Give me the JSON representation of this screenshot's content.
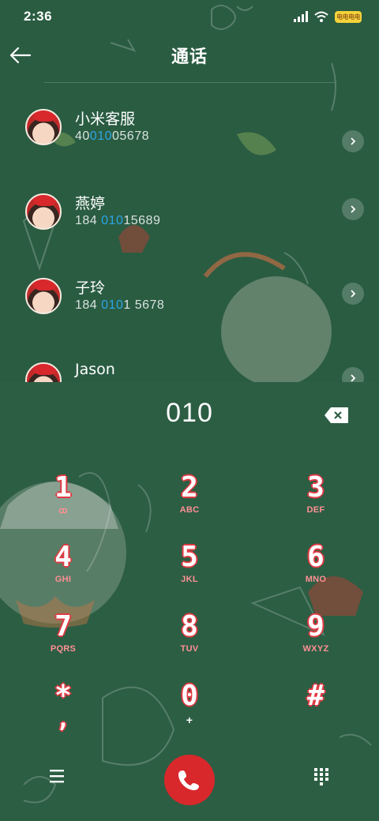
{
  "status_bar": {
    "time": "2:36",
    "battery_label": "电电电电",
    "icons": [
      "signal-icon",
      "wifi-icon",
      "battery-icon"
    ]
  },
  "header": {
    "title": "通话",
    "back_icon": "arrow-left-icon"
  },
  "contacts": [
    {
      "name": "小米客服",
      "number_pre": "40",
      "number_match": "010",
      "number_post": "05678"
    },
    {
      "name": "燕婷",
      "number_pre": "184 ",
      "number_match": "010",
      "number_post": "15689"
    },
    {
      "name": "子玲",
      "number_pre": "184 ",
      "number_match": "010",
      "number_post": "1 5678"
    },
    {
      "name": "Jason",
      "number_pre": "",
      "number_match": "",
      "number_post": ""
    }
  ],
  "dialer": {
    "input_value": "010",
    "backspace_icon": "backspace-icon",
    "keys": [
      {
        "digit": "1",
        "letters": "ꝏ"
      },
      {
        "digit": "2",
        "letters": "ABC"
      },
      {
        "digit": "3",
        "letters": "DEF"
      },
      {
        "digit": "4",
        "letters": "GHI"
      },
      {
        "digit": "5",
        "letters": "JKL"
      },
      {
        "digit": "6",
        "letters": "MNO"
      },
      {
        "digit": "7",
        "letters": "PQRS"
      },
      {
        "digit": "8",
        "letters": "TUV"
      },
      {
        "digit": "9",
        "letters": "WXYZ"
      },
      {
        "digit": "*",
        "letters": ","
      },
      {
        "digit": "0",
        "letters": "+"
      },
      {
        "digit": "#",
        "letters": ""
      }
    ]
  },
  "bottom_bar": {
    "menu_icon": "menu-icon",
    "call_icon": "phone-icon",
    "keypad_icon": "keypad-icon"
  },
  "colors": {
    "background": "#2a5c42",
    "match_highlight": "#2aa6e8",
    "key_outline": "#e13a43",
    "call_button": "#d8282c"
  }
}
